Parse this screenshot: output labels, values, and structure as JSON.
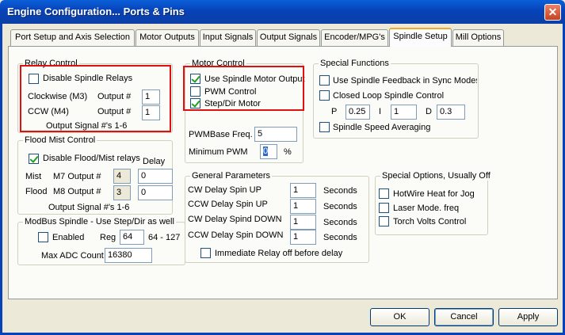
{
  "window": {
    "title": "Engine Configuration... Ports & Pins",
    "close_glyph": "✕"
  },
  "tabs": [
    {
      "label": "Port Setup and Axis Selection"
    },
    {
      "label": "Motor Outputs"
    },
    {
      "label": "Input Signals"
    },
    {
      "label": "Output Signals"
    },
    {
      "label": "Encoder/MPG's"
    },
    {
      "label": "Spindle Setup",
      "active": true
    },
    {
      "label": "Mill Options"
    }
  ],
  "relay_control": {
    "title": "Relay Control",
    "disable_label": "Disable Spindle Relays",
    "disable_checked": false,
    "cw_label": "Clockwise (M3)",
    "cw_output_label": "Output #",
    "cw_output": "1",
    "ccw_label": "CCW (M4)",
    "ccw_output_label": "Output #",
    "ccw_output": "1",
    "note": "Output Signal #'s 1-6"
  },
  "flood_mist": {
    "title": "Flood Mist Control",
    "disable_label": "Disable Flood/Mist relays",
    "disable_checked": true,
    "delay_label": "Delay",
    "mist_label": "Mist",
    "m7_label": "M7 Output #",
    "m7_output": "4",
    "m7_delay": "0",
    "flood_label": "Flood",
    "m8_label": "M8 Output #",
    "m8_output": "3",
    "m8_delay": "0",
    "note": "Output Signal #'s 1-6"
  },
  "modbus": {
    "title": "ModBus Spindle - Use Step/Dir as well",
    "enabled_label": "Enabled",
    "enabled_checked": false,
    "reg_label": "Reg",
    "reg_value": "64",
    "reg_range": "64 - 127",
    "max_adc_label": "Max ADC Count",
    "max_adc_value": "16380"
  },
  "motor_control": {
    "title": "Motor Control",
    "use_spindle_label": "Use Spindle Motor Output",
    "use_spindle_checked": true,
    "pwm_label": "PWM Control",
    "pwm_checked": false,
    "stepdir_label": "Step/Dir Motor",
    "stepdir_checked": true,
    "pwm_base_label": "PWMBase Freq.",
    "pwm_base_value": "5",
    "min_pwm_label": "Minimum PWM",
    "min_pwm_value": "0",
    "min_pwm_unit": "%"
  },
  "special_functions": {
    "title": "Special Functions",
    "feedback_label": "Use Spindle Feedback in Sync Modes",
    "feedback_checked": false,
    "closed_loop_label": "Closed Loop Spindle Control",
    "closed_loop_checked": false,
    "p_label": "P",
    "p_value": "0.25",
    "i_label": "I",
    "i_value": "1",
    "d_label": "D",
    "d_value": "0.3",
    "averaging_label": "Spindle Speed Averaging",
    "averaging_checked": false
  },
  "general": {
    "title": "General Parameters",
    "cw_up_label": "CW Delay Spin UP",
    "cw_up_value": "1",
    "ccw_up_label": "CCW Delay Spin UP",
    "ccw_up_value": "1",
    "cw_down_label": "CW Delay Spind DOWN",
    "cw_down_value": "1",
    "ccw_down_label": "CCW Delay Spin DOWN",
    "ccw_down_value": "1",
    "unit": "Seconds",
    "immediate_label": "Immediate Relay off before delay",
    "immediate_checked": false
  },
  "special_options": {
    "title": "Special Options, Usually Off",
    "hotwire_label": "HotWire Heat for Jog",
    "laser_label": "Laser Mode. freq",
    "torch_label": "Torch Volts Control"
  },
  "buttons": {
    "ok": "OK",
    "cancel": "Cancel",
    "apply": "Apply"
  },
  "colors": {
    "highlight": "#e01010",
    "titlebar": "#0a5fd8"
  }
}
